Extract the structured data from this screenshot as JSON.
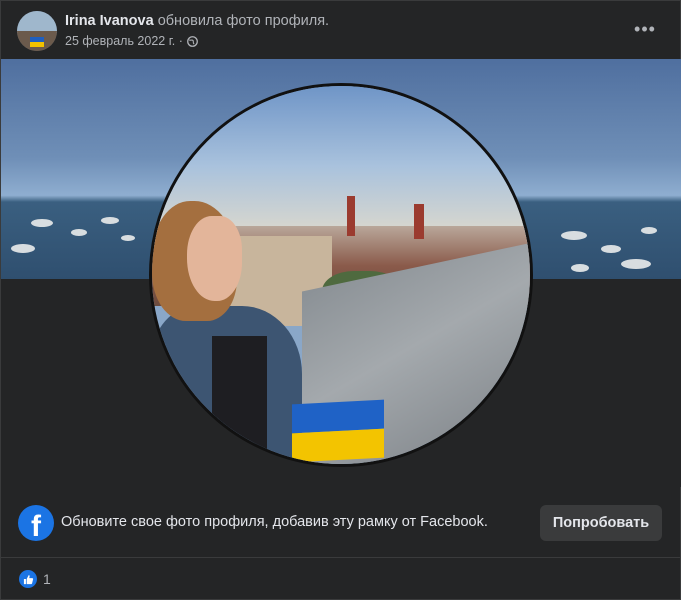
{
  "post": {
    "author_name": "Irina Ivanova",
    "action_text": "обновила фото профиля.",
    "date": "25 февраль 2022 г. ·",
    "privacy_icon": "globe-icon",
    "more_label": "•••"
  },
  "frame_prompt": {
    "text": "Обновите свое фото профиля, добавив эту рамку от Facebook.",
    "button_label": "Попробовать",
    "icon_letter": "f"
  },
  "reactions": {
    "icon": "like-icon",
    "count": "1"
  },
  "colors": {
    "background": "#242526",
    "accent": "#1b74e4",
    "flag_blue": "#1f62c6",
    "flag_yellow": "#f3c400"
  }
}
